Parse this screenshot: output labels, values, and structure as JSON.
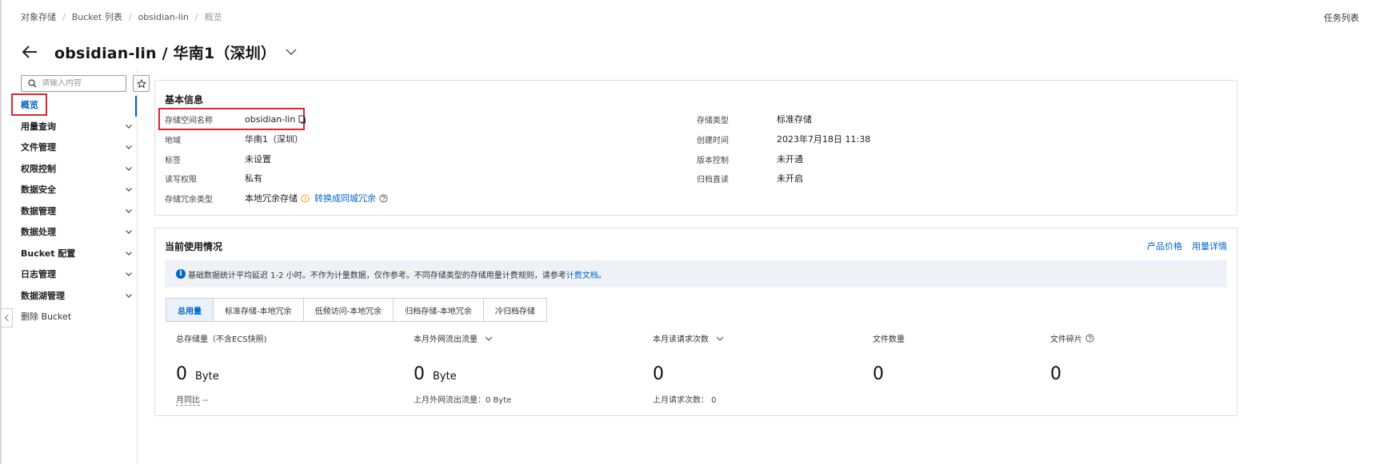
{
  "breadcrumb": [
    "对象存储",
    "Bucket 列表",
    "obsidian-lin",
    "概览"
  ],
  "header": {
    "task_list": "任务列表",
    "title": "obsidian-lin / 华南1（深圳）"
  },
  "sidebar": {
    "search_placeholder": "请输入内容",
    "items": [
      {
        "label": "概览"
      },
      {
        "label": "用量查询"
      },
      {
        "label": "文件管理"
      },
      {
        "label": "权限控制"
      },
      {
        "label": "数据安全"
      },
      {
        "label": "数据管理"
      },
      {
        "label": "数据处理"
      },
      {
        "label": "Bucket 配置"
      },
      {
        "label": "日志管理"
      },
      {
        "label": "数据湖管理"
      },
      {
        "label": "删除 Bucket"
      }
    ]
  },
  "basic_info": {
    "title": "基本信息",
    "left": [
      {
        "label": "存储空间名称",
        "value": "obsidian-lin"
      },
      {
        "label": "地域",
        "value": "华南1（深圳）"
      },
      {
        "label": "标签",
        "value": "未设置"
      },
      {
        "label": "读写权限",
        "value": "私有"
      },
      {
        "label": "存储冗余类型",
        "value": "本地冗余存储",
        "link": "转换成同城冗余"
      }
    ],
    "right": [
      {
        "label": "存储类型",
        "value": "标准存储"
      },
      {
        "label": "创建时间",
        "value": "2023年7月18日 11:38"
      },
      {
        "label": "版本控制",
        "value": "未开通"
      },
      {
        "label": "归档直读",
        "value": "未开启"
      }
    ]
  },
  "usage": {
    "title": "当前使用情况",
    "links": [
      "产品价格",
      "用量详情"
    ],
    "notice_text": "基础数据统计平均延迟 1-2 小时。不作为计量数据，仅作参考。不同存储类型的存储用量计费规则，请参考",
    "notice_link": "计费文档",
    "notice_end": "。",
    "tabs": [
      "总用量",
      "标准存储-本地冗余",
      "低频访问-本地冗余",
      "归档存储-本地冗余",
      "冷归档存储"
    ],
    "metrics": [
      {
        "label": "总存储量（不含ECS快照)",
        "value": "0",
        "unit": "Byte",
        "sub_label": "月同比",
        "sub_value": " --"
      },
      {
        "label": "本月外网流出流量",
        "value": "0",
        "unit": "Byte",
        "sub_label": "上月外网流出流量：",
        "sub_value": "0 Byte"
      },
      {
        "label": "本月读请求次数",
        "value": "0",
        "unit": "",
        "sub_label": "上月请求次数：",
        "sub_value": " 0"
      },
      {
        "label": "文件数量",
        "value": "0",
        "unit": ""
      },
      {
        "label": "文件碎片",
        "value": "0",
        "unit": ""
      }
    ]
  },
  "colors": {
    "accent": "#0064c8",
    "highlight_red": "#e0242a",
    "notice_bg": "#eef2f7"
  }
}
